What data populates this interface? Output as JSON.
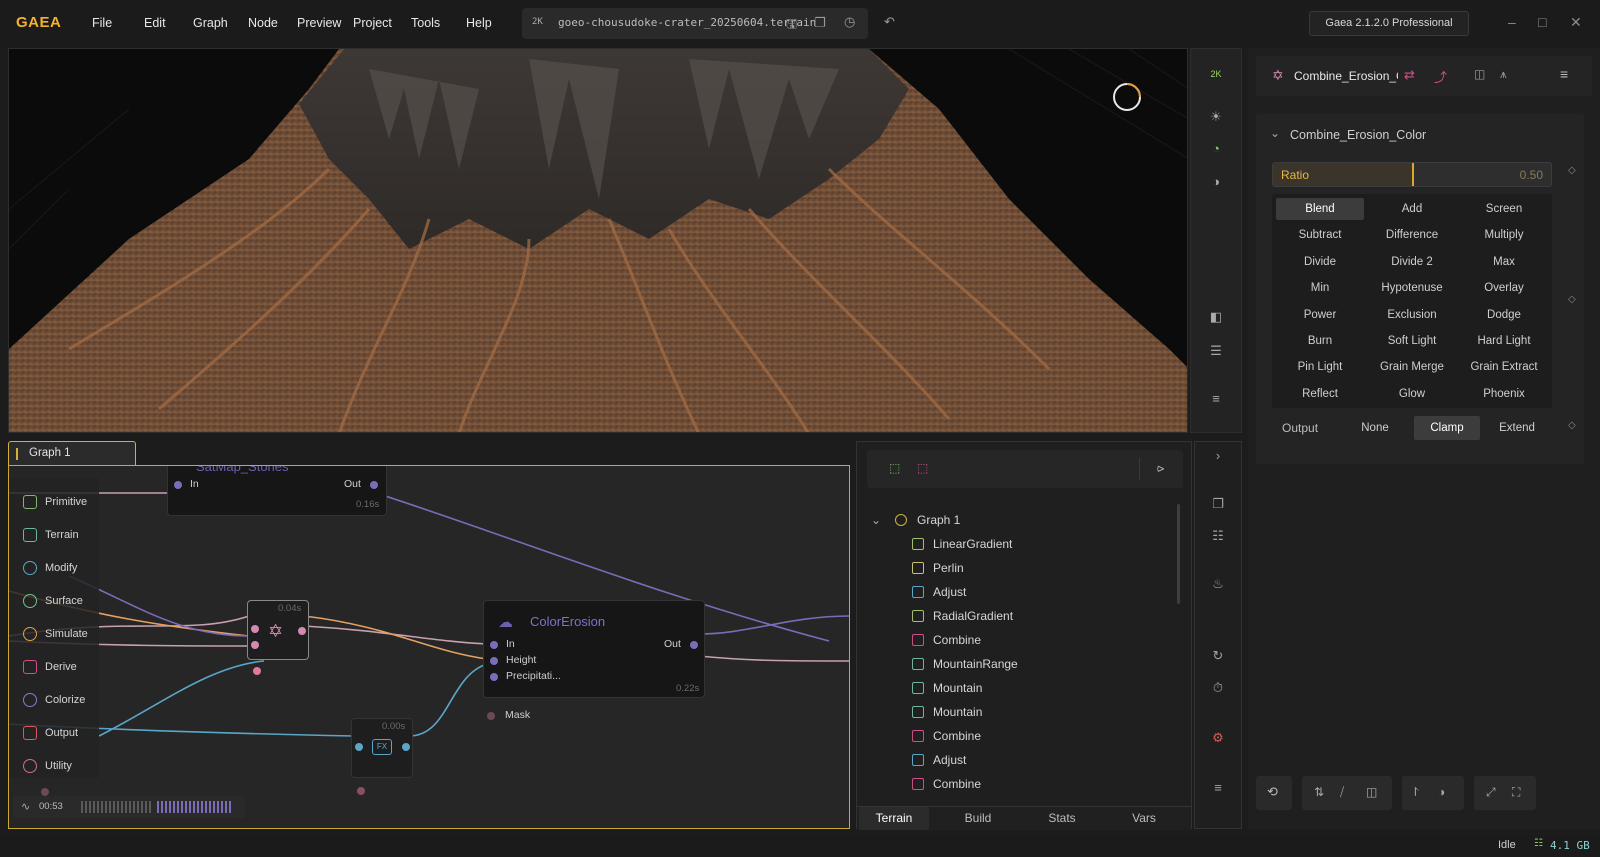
{
  "app": {
    "logo": "GAEA",
    "version": "Gaea 2.1.2.0 Professional"
  },
  "menu": [
    "File",
    "Edit",
    "Graph",
    "Node",
    "Preview",
    "Project",
    "Tools",
    "Help"
  ],
  "file": {
    "resolution": "2K",
    "name": "goeo-chousudoke-crater_20250604.terrain"
  },
  "viewport": {
    "resolution_badge": "2K"
  },
  "graph": {
    "tab_label": "Graph 1",
    "palette": [
      {
        "label": "Primitive",
        "color": "#7fb86a"
      },
      {
        "label": "Terrain",
        "color": "#6bb79a"
      },
      {
        "label": "Modify",
        "color": "#5aa6c9"
      },
      {
        "label": "Surface",
        "color": "#6fc48f"
      },
      {
        "label": "Simulate",
        "color": "#e0a04a"
      },
      {
        "label": "Derive",
        "color": "#d0508c"
      },
      {
        "label": "Colorize",
        "color": "#8f78c8"
      },
      {
        "label": "Output",
        "color": "#d85a5a"
      },
      {
        "label": "Utility",
        "color": "#d06aa0"
      }
    ],
    "satmap": {
      "title": "SatMap_Stones",
      "in": "In",
      "out": "Out",
      "time": "0.16s"
    },
    "combine_node": {
      "time": "0.04s"
    },
    "fx_node": {
      "time": "0.00s"
    },
    "color_erosion": {
      "title": "ColorErosion",
      "in": "In",
      "height": "Height",
      "precip": "Precipitati...",
      "out": "Out",
      "mask": "Mask",
      "time": "0.22s"
    },
    "timeline": "00:53"
  },
  "tree": {
    "root": "Graph 1",
    "items": [
      {
        "label": "LinearGradient",
        "color": "#9fc06a"
      },
      {
        "label": "Perlin",
        "color": "#c8c06a"
      },
      {
        "label": "Adjust",
        "color": "#5aa6c9"
      },
      {
        "label": "RadialGradient",
        "color": "#9fc06a"
      },
      {
        "label": "Combine",
        "color": "#d0508c"
      },
      {
        "label": "MountainRange",
        "color": "#6bb79a"
      },
      {
        "label": "Mountain",
        "color": "#6bb79a"
      },
      {
        "label": "Mountain",
        "color": "#6bb79a"
      },
      {
        "label": "Combine",
        "color": "#d0508c"
      },
      {
        "label": "Adjust",
        "color": "#5aa6c9"
      },
      {
        "label": "Combine",
        "color": "#d0508c"
      }
    ],
    "tabs": [
      "Terrain",
      "Build",
      "Stats",
      "Vars"
    ]
  },
  "props": {
    "node_short": "Combine_Erosion_Co",
    "node_full": "Combine_Erosion_Color",
    "ratio": {
      "label": "Ratio",
      "value": "0.50",
      "fraction": 0.5
    },
    "blend_modes": [
      "Blend",
      "Add",
      "Screen",
      "Subtract",
      "Difference",
      "Multiply",
      "Divide",
      "Divide 2",
      "Max",
      "Min",
      "Hypotenuse",
      "Overlay",
      "Power",
      "Exclusion",
      "Dodge",
      "Burn",
      "Soft Light",
      "Hard Light",
      "Pin Light",
      "Grain Merge",
      "Grain Extract",
      "Reflect",
      "Glow",
      "Phoenix"
    ],
    "active_blend": "Blend",
    "output": {
      "label": "Output",
      "options": [
        "None",
        "Clamp",
        "Extend"
      ],
      "active": "Clamp"
    }
  },
  "status": {
    "state": "Idle",
    "memory": "4.1 GB"
  }
}
